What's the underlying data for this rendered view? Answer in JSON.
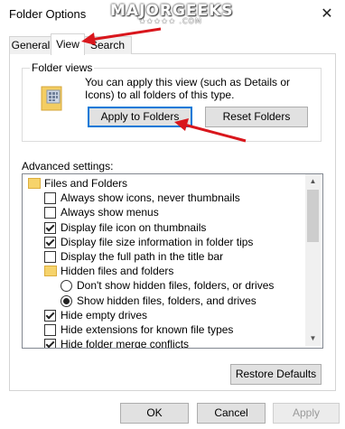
{
  "window": {
    "title": "Folder Options",
    "close_glyph": "✕"
  },
  "watermark": {
    "text": "MAJORGEEKS",
    "sub": "★★★★★ .COM"
  },
  "tabs": [
    {
      "label": "General"
    },
    {
      "label": "View"
    },
    {
      "label": "Search"
    }
  ],
  "folder_views": {
    "group_label": "Folder views",
    "description": "You can apply this view (such as Details or Icons) to all folders of this type.",
    "apply_button": "Apply to Folders",
    "reset_button": "Reset Folders"
  },
  "advanced": {
    "label": "Advanced settings:",
    "items": [
      {
        "type": "folder",
        "label": "Files and Folders",
        "indent": 0
      },
      {
        "type": "checkbox",
        "label": "Always show icons, never thumbnails",
        "checked": false,
        "indent": 1
      },
      {
        "type": "checkbox",
        "label": "Always show menus",
        "checked": false,
        "indent": 1
      },
      {
        "type": "checkbox",
        "label": "Display file icon on thumbnails",
        "checked": true,
        "indent": 1
      },
      {
        "type": "checkbox",
        "label": "Display file size information in folder tips",
        "checked": true,
        "indent": 1
      },
      {
        "type": "checkbox",
        "label": "Display the full path in the title bar",
        "checked": false,
        "indent": 1
      },
      {
        "type": "folder",
        "label": "Hidden files and folders",
        "indent": 1
      },
      {
        "type": "radio",
        "label": "Don't show hidden files, folders, or drives",
        "checked": false,
        "indent": 2
      },
      {
        "type": "radio",
        "label": "Show hidden files, folders, and drives",
        "checked": true,
        "indent": 2
      },
      {
        "type": "checkbox",
        "label": "Hide empty drives",
        "checked": true,
        "indent": 1
      },
      {
        "type": "checkbox",
        "label": "Hide extensions for known file types",
        "checked": false,
        "indent": 1
      },
      {
        "type": "checkbox",
        "label": "Hide folder merge conflicts",
        "checked": true,
        "indent": 1
      }
    ],
    "restore_button": "Restore Defaults"
  },
  "footer": {
    "ok": "OK",
    "cancel": "Cancel",
    "apply": "Apply"
  },
  "colors": {
    "arrow": "#d9161c",
    "focus": "#0078d7"
  }
}
